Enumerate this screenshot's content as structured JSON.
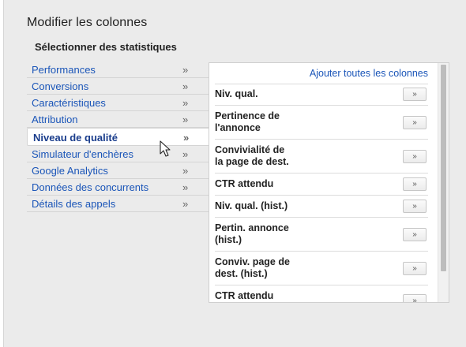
{
  "dialog": {
    "title": "Modifier les colonnes",
    "section_title": "Sélectionner des statistiques"
  },
  "categories": [
    {
      "label": "Performances",
      "chevron": "»"
    },
    {
      "label": "Conversions",
      "chevron": "»"
    },
    {
      "label": "Caractéristiques",
      "chevron": "»"
    },
    {
      "label": "Attribution",
      "chevron": "»"
    },
    {
      "label": "Niveau de qualité",
      "chevron": "»",
      "selected": true
    },
    {
      "label": "Simulateur d'enchères",
      "chevron": "»"
    },
    {
      "label": "Google Analytics",
      "chevron": "»"
    },
    {
      "label": "Données des concurrents",
      "chevron": "»"
    },
    {
      "label": "Détails des appels",
      "chevron": "»"
    }
  ],
  "panel": {
    "add_all": "Ajouter toutes les colonnes",
    "add_button": "»",
    "metrics": [
      "Niv. qual.",
      "Pertinence de\nl'annonce",
      "Convivialité de\nla page de dest.",
      "CTR attendu",
      "Niv. qual. (hist.)",
      "Pertin. annonce\n(hist.)",
      "Conviv. page de\ndest. (hist.)",
      "CTR attendu"
    ]
  },
  "colors": {
    "link": "#1a55b8",
    "dialog_bg": "#ebebeb"
  }
}
